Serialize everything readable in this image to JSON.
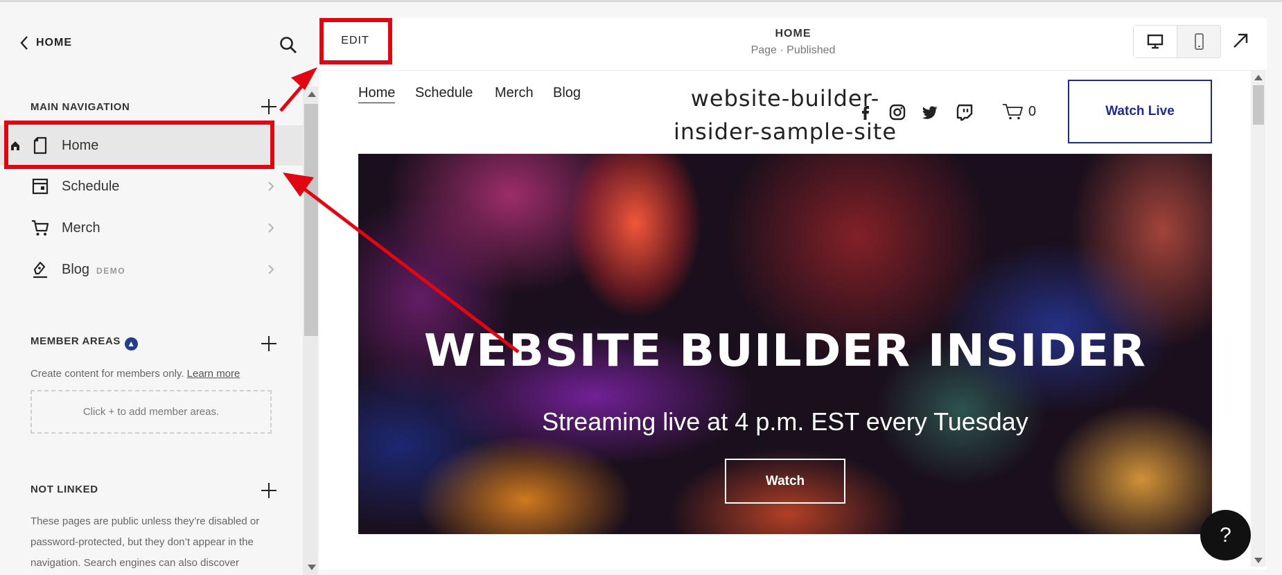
{
  "sidebar": {
    "back_label": "HOME",
    "main_navigation": {
      "title": "MAIN NAVIGATION",
      "items": [
        {
          "label": "Home",
          "icon": "page-icon",
          "active": true
        },
        {
          "label": "Schedule",
          "icon": "calendar-icon"
        },
        {
          "label": "Merch",
          "icon": "cart-icon"
        },
        {
          "label": "Blog",
          "icon": "blog-icon",
          "badge": "DEMO"
        }
      ]
    },
    "member_areas": {
      "title": "MEMBER AREAS",
      "text": "Create content for members only.",
      "link": "Learn more",
      "placeholder": "Click + to add member areas."
    },
    "not_linked": {
      "title": "NOT LINKED",
      "lines": [
        "These pages are public unless they’re disabled or",
        "password-protected, but they don’t appear in the",
        "navigation. Search engines can also discover"
      ]
    }
  },
  "topbar": {
    "edit_label": "EDIT",
    "page_title": "HOME",
    "page_status": "Page · Published"
  },
  "site": {
    "nav": [
      "Home",
      "Schedule",
      "Merch",
      "Blog"
    ],
    "title_line1": "website-builder-",
    "title_line2": "insider-sample-site",
    "social_icons": [
      "facebook-icon",
      "instagram-icon",
      "twitter-icon",
      "twitch-icon"
    ],
    "cart_count": "0",
    "cta_label": "Watch Live",
    "hero": {
      "title": "WEBSITE BUILDER INSIDER",
      "subtitle": "Streaming live at 4 p.m. EST every Tuesday",
      "button_label": "Watch"
    }
  },
  "help_label": "?",
  "colors": {
    "highlight": "#e00612",
    "cta": "#1e2b8e",
    "members_badge": "#263c8c"
  }
}
